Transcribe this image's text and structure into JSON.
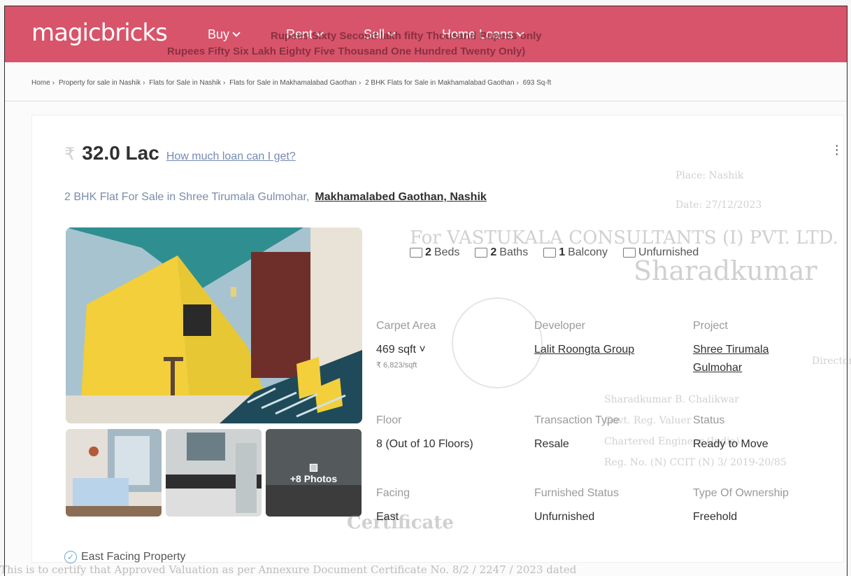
{
  "header": {
    "logo": "magicbricks",
    "nav": [
      "Buy",
      "Rent",
      "Sell",
      "Home Loans"
    ],
    "bleed_line_1": "Rupees Sixty Second lakh fifty Thousand Rupees only",
    "bleed_line_2": "Rupees Fifty Six Lakh Eighty Five Thousand One Hundred Twenty Only)"
  },
  "breadcrumb": [
    "Home",
    "Property for sale in Nashik",
    "Flats for Sale in Nashik",
    "Flats for Sale in Makhamalabad Gaothan",
    "2 BHK Flats for Sale in Makhamalabad Gaothan",
    "693 Sq-ft"
  ],
  "listing": {
    "rupee": "₹",
    "price": "32.0 Lac",
    "loan_link": "How much loan can I get?",
    "subtitle": "2 BHK Flat For Sale in Shree Tirumala Gulmohar,",
    "location": "Makhamalabed Gaothan, Nashik",
    "more_photos": "+8 Photos"
  },
  "amenities": {
    "beds_num": "2",
    "beds": "Beds",
    "baths_num": "2",
    "baths": "Baths",
    "balcony_num": "1",
    "balcony": "Balcony",
    "furnishing": "Unfurnished"
  },
  "summary": [
    {
      "label": "Carpet Area",
      "value": "469 sqft ˅",
      "sub": "₹ 6,823/sqft",
      "link": false
    },
    {
      "label": "Developer",
      "value": "Lalit Roongta Group",
      "link": true
    },
    {
      "label": "Project",
      "value": "Shree Tirumala Gulmohar",
      "link": true
    },
    {
      "label": "Floor",
      "value": "8 (Out of 10 Floors)",
      "link": false
    },
    {
      "label": "Transaction Type",
      "value": "Resale",
      "link": false
    },
    {
      "label": "Status",
      "value": "Ready to Move",
      "link": false
    },
    {
      "label": "Facing",
      "value": "East",
      "link": false
    },
    {
      "label": "Furnished Status",
      "value": "Unfurnished",
      "link": false
    },
    {
      "label": "Type Of Ownership",
      "value": "Freehold",
      "link": false
    }
  ],
  "facing_note": "East Facing Property",
  "ghost": {
    "place": "Place: Nashik",
    "date": "Date: 27/12/2023",
    "company": "For VASTUKALA CONSULTANTS (I) PVT. LTD.",
    "signature": "Sharadkumar",
    "director": "Director",
    "name": "Sharadkumar B. Chalikwar",
    "reg": "Govt. Reg. Valuer",
    "chartered": "Chartered Engineer (India)",
    "reg_no": "Reg. No. (N) CCIT (N) 3/ 2019-20/85",
    "certificate": "Certificate",
    "bottom": "This is to certify that Approved Valuation as per Annexure Document Certificate No. 8/2 / 2247 / 2023 dated"
  }
}
